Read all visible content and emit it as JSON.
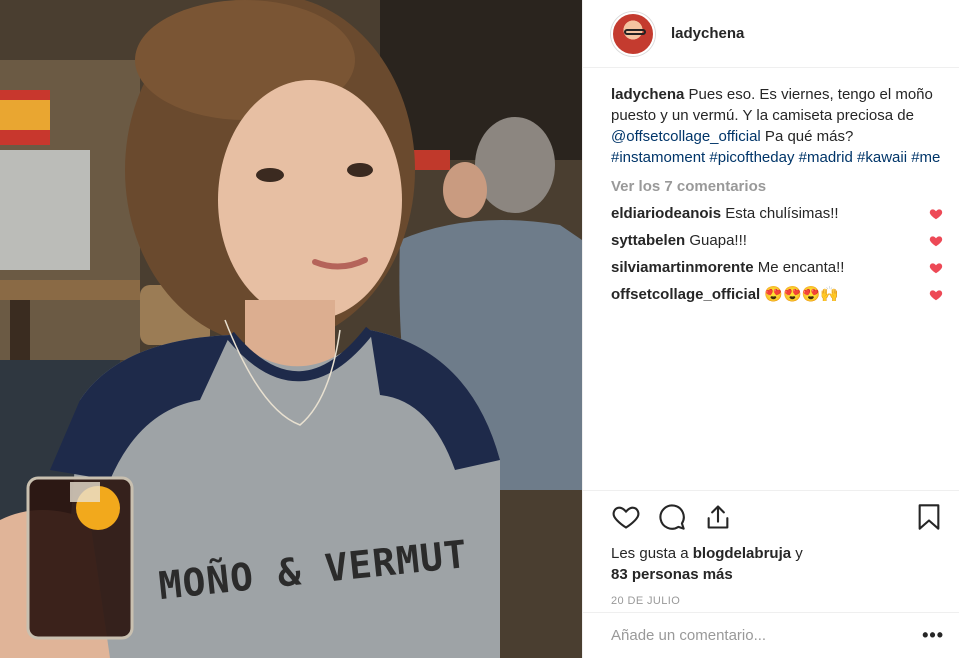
{
  "header": {
    "username": "ladychena"
  },
  "caption": {
    "username": "ladychena",
    "text_1": " Pues eso. Es viernes, tengo el moño puesto y un vermú. Y la camiseta preciosa de ",
    "mention": "@offsetcollage_official",
    "text_2": " Pa qué más? ",
    "hashtags": [
      "#instamoment",
      "#picoftheday",
      "#madrid",
      "#kawaii",
      "#me"
    ]
  },
  "view_all": "Ver los 7 comentarios",
  "comments": [
    {
      "user": "eldiariodeanois",
      "text": "Esta chulísimas!!"
    },
    {
      "user": "syttabelen",
      "text": "Guapa!!!"
    },
    {
      "user": "silviamartinmorente",
      "text": "Me encanta!!"
    },
    {
      "user": "offsetcollage_official",
      "text": "😍😍😍🙌"
    }
  ],
  "likes": {
    "prefix": "Les gusta a ",
    "user": "blogdelabruja",
    "suffix": " y",
    "others": "83 personas más"
  },
  "date": "20 DE JULIO",
  "add_comment": {
    "placeholder": "Añade un comentario...",
    "more": "•••"
  },
  "photo": {
    "shirt_text": "MOÑO & VERMUT"
  },
  "colors": {
    "heart": "#ed4956",
    "link": "#003569",
    "muted": "#999999"
  }
}
